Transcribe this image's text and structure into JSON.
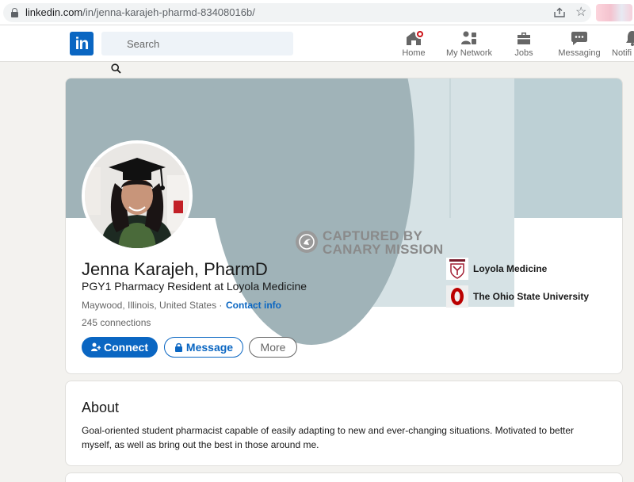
{
  "browser": {
    "url_host": "linkedin.com",
    "url_path": "/in/jenna-karajeh-pharmd-83408016b/"
  },
  "nav": {
    "logo": "in",
    "search_placeholder": "Search",
    "items": [
      {
        "label": "Home"
      },
      {
        "label": "My Network"
      },
      {
        "label": "Jobs"
      },
      {
        "label": "Messaging"
      },
      {
        "label": "Notifi"
      }
    ]
  },
  "profile": {
    "name": "Jenna Karajeh, PharmD",
    "headline": "PGY1 Pharmacy Resident at Loyola Medicine",
    "location": "Maywood, Illinois, United States",
    "location_sep": " · ",
    "contact_info": "Contact info",
    "connections": "245 connections",
    "buttons": {
      "connect": "Connect",
      "message": "Message",
      "more": "More"
    },
    "education": [
      {
        "name": "Loyola Medicine"
      },
      {
        "name": "The Ohio State University"
      }
    ]
  },
  "watermark": {
    "line1": "CAPTURED BY",
    "line2": "CANARY MISSION"
  },
  "about": {
    "title": "About",
    "text": "Goal-oriented student pharmacist capable of easily adapting to new and ever-changing situations. Motivated to better myself, as well as bring out the best in those around me."
  },
  "colors": {
    "brand": "#0a66c2",
    "badge": "#cc1016",
    "banner": "#a0b3b8"
  }
}
